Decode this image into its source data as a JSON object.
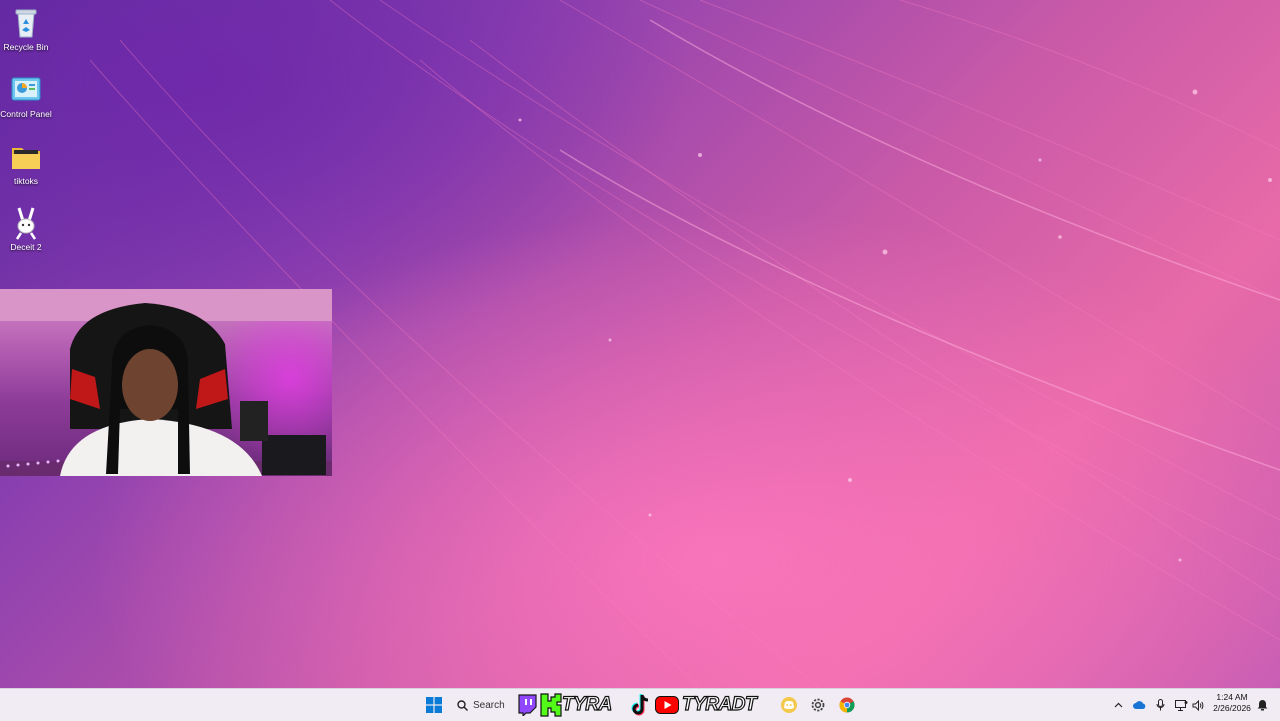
{
  "desktop": {
    "icons": [
      {
        "label": "Recycle Bin"
      },
      {
        "label": "Control Panel"
      },
      {
        "label": "tiktoks"
      },
      {
        "label": "Deceit 2"
      }
    ]
  },
  "taskbar": {
    "search_label": "Search",
    "kick_name": "TYRA",
    "youtube_name": "TYRADT",
    "clock": {
      "time": "1:24 AM",
      "date": "2/26/2026"
    }
  },
  "colors": {
    "twitch": "#9146ff",
    "kick": "#53fc18",
    "youtube": "#ff0000",
    "discord": "#f2c94c",
    "windows_blue": "#0a7bd6"
  }
}
